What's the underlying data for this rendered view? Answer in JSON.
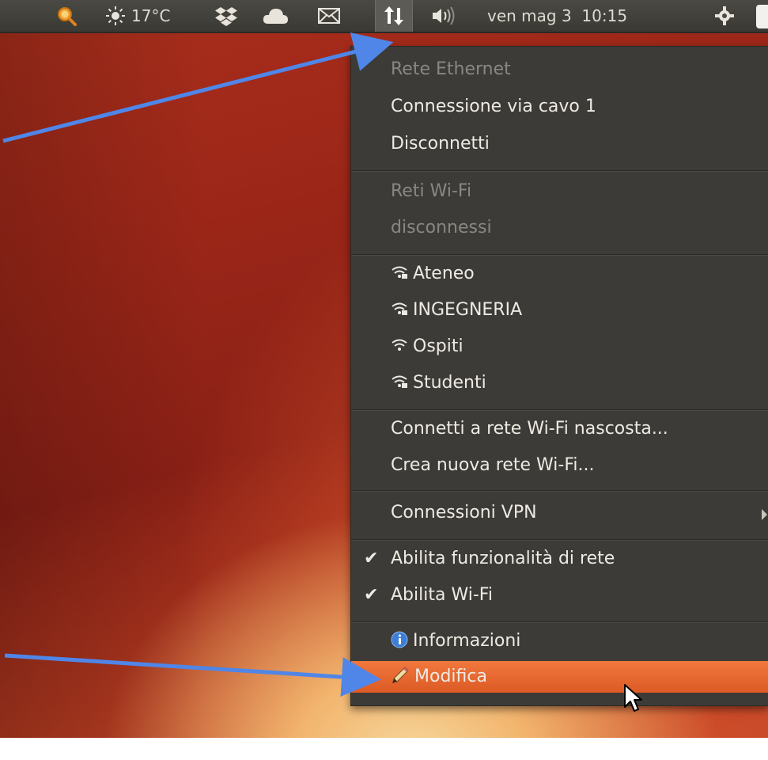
{
  "topbar": {
    "weather": "17°C",
    "datetime": "ven mag 3  10:15"
  },
  "menu": {
    "ethernet_header": "Rete Ethernet",
    "ethernet_connection": "Connessione via cavo 1",
    "disconnect": "Disconnetti",
    "wifi_header": "Reti Wi-Fi",
    "wifi_status": "disconnessi",
    "networks": [
      {
        "name": "Ateneo",
        "secure": true
      },
      {
        "name": "INGEGNERIA",
        "secure": true
      },
      {
        "name": "Ospiti",
        "secure": false
      },
      {
        "name": "Studenti",
        "secure": true
      }
    ],
    "connect_hidden": "Connetti a rete Wi-Fi nascosta...",
    "create_new": "Crea nuova rete Wi-Fi...",
    "vpn": "Connessioni VPN",
    "enable_networking": "Abilita funzionalità di rete",
    "enable_wifi": "Abilita Wi-Fi",
    "info": "Informazioni",
    "edit": "Modifica"
  },
  "colors": {
    "panel": "#3c3b37",
    "highlight": "#e7662f",
    "annotation_arrow": "#4f86e8"
  },
  "icons": [
    "search-icon",
    "weather-sun-icon",
    "dropbox-icon",
    "cloud-icon",
    "mail-icon",
    "network-icon",
    "volume-icon",
    "power-gear-icon",
    "wifi-icon",
    "info-icon",
    "pencil-icon",
    "mouse-cursor-icon"
  ]
}
